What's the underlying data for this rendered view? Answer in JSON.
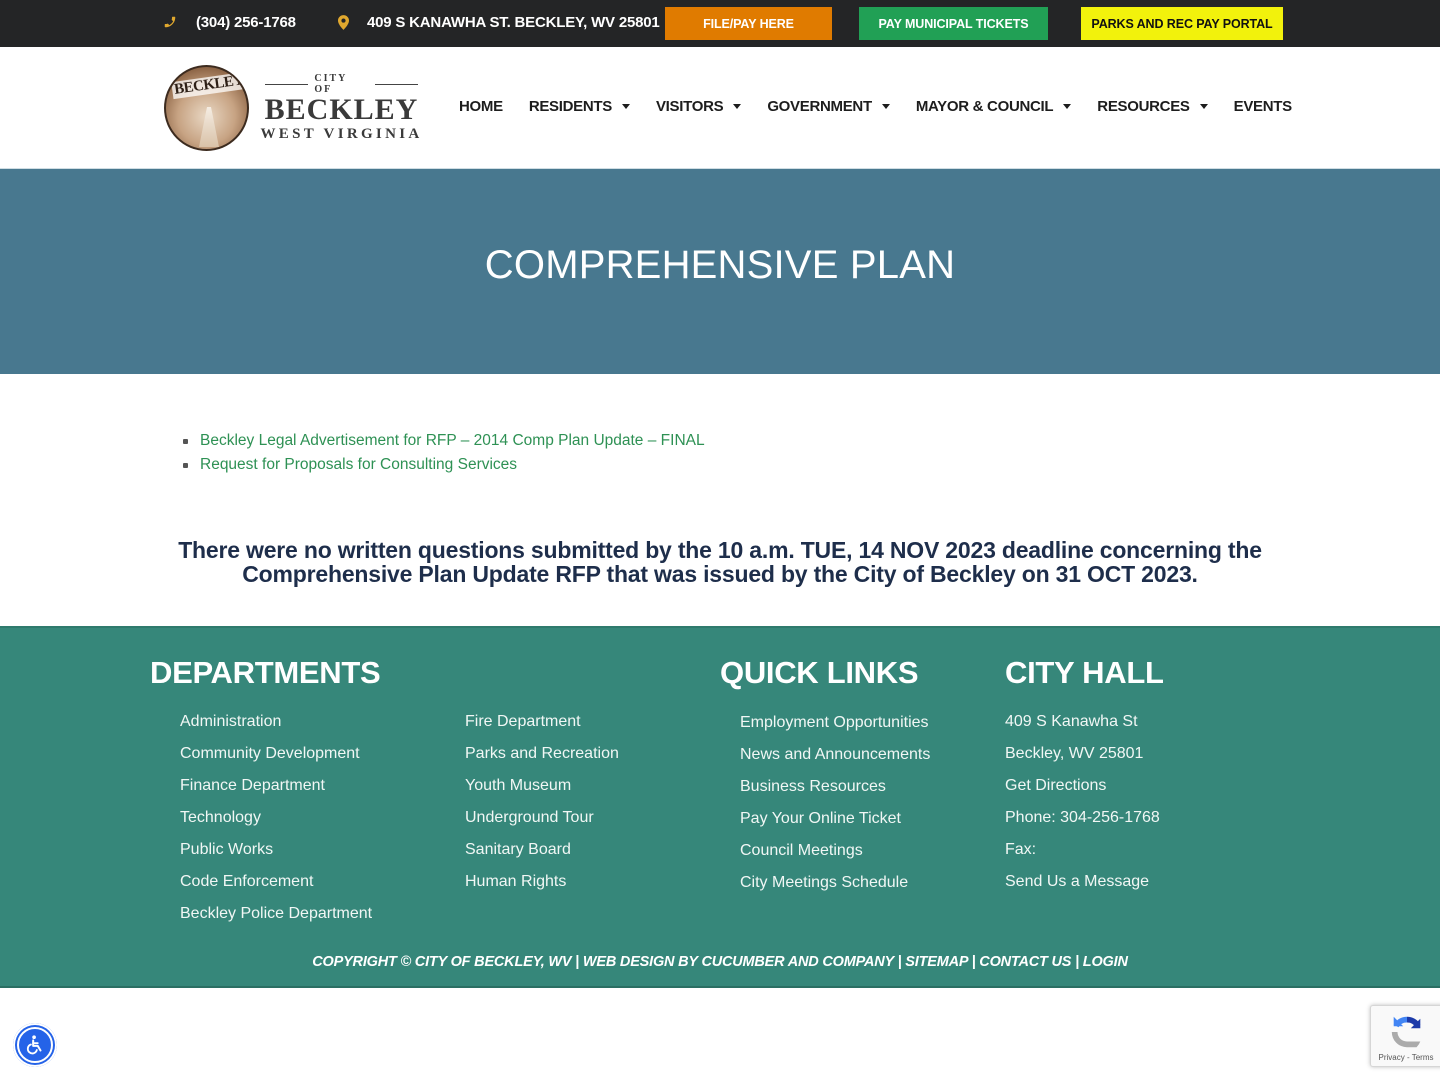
{
  "topbar": {
    "phone": "(304) 256-1768",
    "address": "409 S KANAWHA ST. BECKLEY, WV 25801",
    "buttons": [
      {
        "label": "FILE/PAY HERE",
        "color": "#e07b00"
      },
      {
        "label": "PAY MUNICIPAL TICKETS",
        "color": "#21a055"
      },
      {
        "label": "PARKS AND REC PAY PORTAL",
        "color": "#f2f20c"
      }
    ]
  },
  "logo": {
    "seal_text": "BECKLEY",
    "city_of": "CITY OF",
    "name": "BECKLEY",
    "state": "WEST VIRGINIA"
  },
  "nav": {
    "items": [
      {
        "label": "HOME",
        "dropdown": false
      },
      {
        "label": "RESIDENTS",
        "dropdown": true
      },
      {
        "label": "VISITORS",
        "dropdown": true
      },
      {
        "label": "GOVERNMENT",
        "dropdown": true
      },
      {
        "label": "MAYOR & COUNCIL",
        "dropdown": true
      },
      {
        "label": "RESOURCES",
        "dropdown": true
      },
      {
        "label": "EVENTS",
        "dropdown": false
      }
    ]
  },
  "hero": {
    "title": "COMPREHENSIVE PLAN",
    "background": "#48788f"
  },
  "content": {
    "documents": [
      "Beckley Legal Advertisement for RFP – 2014 Comp Plan Update – FINAL",
      "Request for Proposals for Consulting Services"
    ],
    "notice": "There were no written questions submitted by the 10 a.m. TUE, 14 NOV 2023 deadline concerning the Comprehensive Plan Update RFP that was issued by the City of Beckley on 31 OCT 2023.",
    "link_color": "#2e9154"
  },
  "footer": {
    "background": "#36877a",
    "departments": {
      "heading": "DEPARTMENTS",
      "col1": [
        "Administration",
        "Community Development",
        "Finance Department",
        "Technology",
        "Public Works",
        "Code Enforcement",
        "Beckley Police Department"
      ],
      "col2": [
        "Fire Department",
        "Parks and Recreation",
        "Youth Museum",
        "Underground Tour",
        "Sanitary Board",
        "Human Rights"
      ]
    },
    "quick_links": {
      "heading": "QUICK LINKS",
      "items": [
        "Employment Opportunities",
        "News and Announcements",
        "Business Resources",
        "Pay Your Online Ticket",
        "Council Meetings",
        "City Meetings Schedule"
      ]
    },
    "city_hall": {
      "heading": "CITY HALL",
      "items": [
        "409 S Kanawha St",
        "Beckley, WV 25801",
        "Get Directions",
        "Phone: 304-256-1768",
        "Fax:",
        "Send Us a Message"
      ]
    },
    "copyright": {
      "text": "COPYRIGHT © CITY OF BECKLEY, WV",
      "separator": " | ",
      "webdesign": "WEB DESIGN BY CUCUMBER AND COMPANY",
      "sitemap": "SITEMAP",
      "contact": "CONTACT US",
      "login": "LOGIN"
    }
  },
  "widgets": {
    "accessibility_icon": "wheelchair-icon",
    "recaptcha_text": "Privacy - Terms"
  }
}
